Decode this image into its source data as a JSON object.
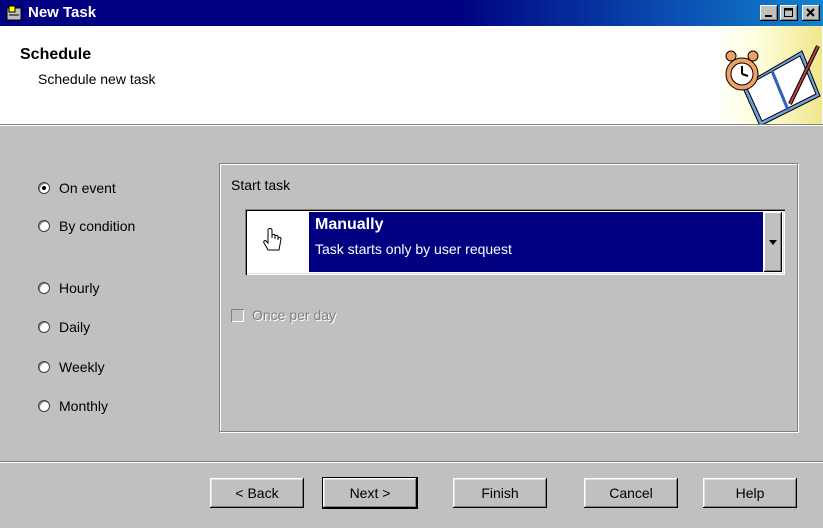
{
  "window": {
    "title": "New Task",
    "controls": {
      "minimize": "_",
      "maximize": "□",
      "close": "×"
    }
  },
  "header": {
    "title": "Schedule",
    "subtitle": "Schedule new task",
    "illustration": "clock-and-calendar"
  },
  "schedule_options": [
    {
      "label": "On event",
      "selected": true
    },
    {
      "label": "By condition",
      "selected": false
    },
    {
      "label": "Hourly",
      "selected": false
    },
    {
      "label": "Daily",
      "selected": false
    },
    {
      "label": "Weekly",
      "selected": false
    },
    {
      "label": "Monthly",
      "selected": false
    }
  ],
  "start_task": {
    "group_label": "Start task",
    "selected_option": {
      "title": "Manually",
      "description": "Task starts only by user request",
      "icon": "hand-cursor-icon"
    },
    "once_per_day": {
      "label": "Once per day",
      "checked": false,
      "enabled": false
    }
  },
  "buttons": {
    "back": "< Back",
    "next": "Next >",
    "finish": "Finish",
    "cancel": "Cancel",
    "help": "Help"
  },
  "colors": {
    "titlebar": "#000080",
    "selection": "#000080",
    "face": "#c0c0c0"
  }
}
